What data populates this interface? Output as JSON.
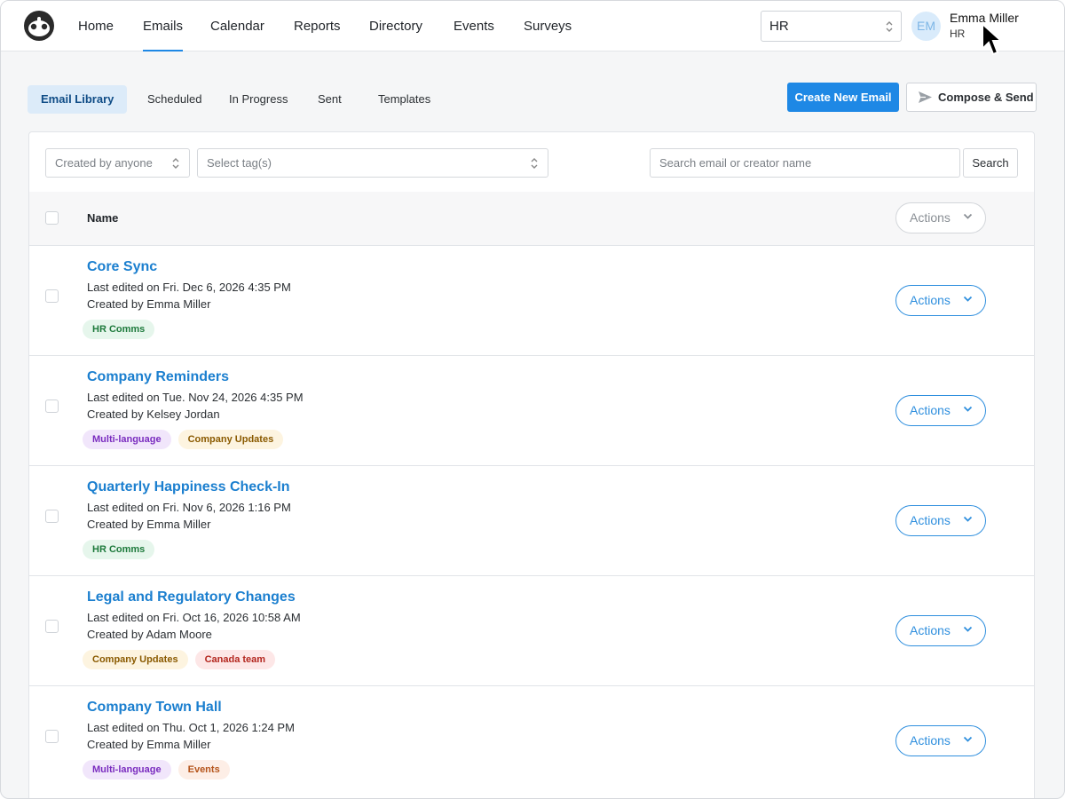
{
  "nav": {
    "items": [
      {
        "label": "Home"
      },
      {
        "label": "Emails"
      },
      {
        "label": "Calendar"
      },
      {
        "label": "Reports"
      },
      {
        "label": "Directory"
      },
      {
        "label": "Events"
      },
      {
        "label": "Surveys"
      }
    ],
    "active": "Emails",
    "workspace_select": "HR",
    "user": {
      "initials": "EM",
      "name": "Emma Miller",
      "role": "HR"
    }
  },
  "subtabs": [
    {
      "label": "Email Library",
      "active": true
    },
    {
      "label": "Scheduled"
    },
    {
      "label": "In Progress"
    },
    {
      "label": "Sent"
    },
    {
      "label": "Templates"
    }
  ],
  "toolbar": {
    "create_label": "Create New Email",
    "compose_label": "Compose & Send"
  },
  "filters": {
    "created_by": "Created by anyone",
    "tags_placeholder": "Select tag(s)",
    "search_placeholder": "Search email or creator name",
    "search_button": "Search"
  },
  "table": {
    "header_name": "Name",
    "header_actions": "Actions",
    "rows": [
      {
        "title": "Core Sync",
        "edited": "Last edited on Fri. Dec 6, 2026 4:35 PM",
        "creator": "Created by Emma Miller",
        "actions": "Actions",
        "tags": [
          {
            "label": "HR Comms",
            "bg": "#e6f6ec",
            "fg": "#1e7a3c"
          }
        ]
      },
      {
        "title": "Company Reminders",
        "edited": "Last edited on Tue. Nov 24, 2026 4:35 PM",
        "creator": "Created by Kelsey Jordan",
        "actions": "Actions",
        "tags": [
          {
            "label": "Multi-language",
            "bg": "#f1e6fb",
            "fg": "#7a2cbf"
          },
          {
            "label": "Company Updates",
            "bg": "#fdf4e0",
            "fg": "#8a5a00"
          }
        ]
      },
      {
        "title": "Quarterly Happiness Check-In",
        "edited": "Last edited on Fri. Nov 6, 2026 1:16 PM",
        "creator": "Created by Emma Miller",
        "actions": "Actions",
        "tags": [
          {
            "label": "HR Comms",
            "bg": "#e6f6ec",
            "fg": "#1e7a3c"
          }
        ]
      },
      {
        "title": "Legal and Regulatory Changes",
        "edited": "Last edited on Fri. Oct 16, 2026 10:58 AM",
        "creator": "Created by Adam Moore",
        "actions": "Actions",
        "tags": [
          {
            "label": "Company Updates",
            "bg": "#fdf4e0",
            "fg": "#8a5a00"
          },
          {
            "label": "Canada team",
            "bg": "#fde7e7",
            "fg": "#b3261e"
          }
        ]
      },
      {
        "title": "Company Town Hall",
        "edited": "Last edited on Thu. Oct 1, 2026 1:24 PM",
        "creator": "Created by Emma Miller",
        "actions": "Actions",
        "tags": [
          {
            "label": "Multi-language",
            "bg": "#f1e6fb",
            "fg": "#7a2cbf"
          },
          {
            "label": "Events",
            "bg": "#fdeee6",
            "fg": "#b5541a"
          }
        ]
      }
    ]
  },
  "colors": {
    "accent": "#1e88e5",
    "link": "#1b7fcf",
    "active_tab_bg": "#dcebf9"
  }
}
